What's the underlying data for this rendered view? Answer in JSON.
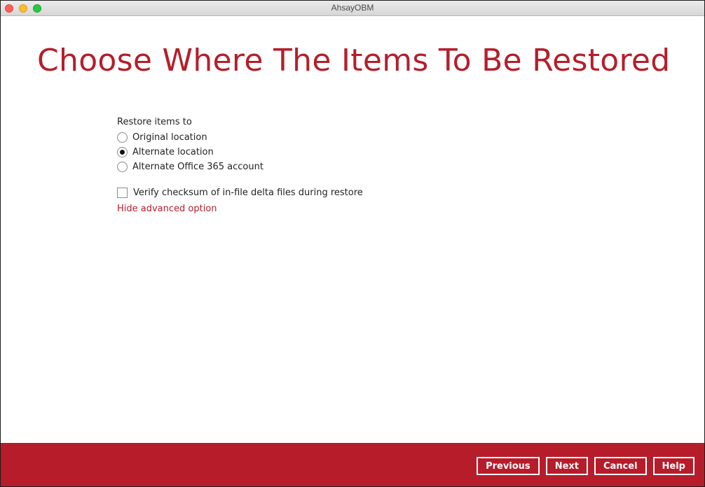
{
  "window": {
    "title": "AhsayOBM"
  },
  "page": {
    "title": "Choose Where The Items To Be Restored"
  },
  "restore": {
    "label": "Restore items to",
    "options": [
      {
        "label": "Original location",
        "selected": false
      },
      {
        "label": "Alternate location",
        "selected": true
      },
      {
        "label": "Alternate Office 365 account",
        "selected": false
      }
    ],
    "verify_checksum_label": "Verify checksum of in-file delta files during restore",
    "verify_checksum_checked": false,
    "advanced_link": "Hide advanced option"
  },
  "footer": {
    "previous_label": "Previous",
    "next_label": "Next",
    "cancel_label": "Cancel",
    "help_label": "Help"
  },
  "colors": {
    "accent": "#b41f2b",
    "footer_bg": "#b71c2a"
  }
}
